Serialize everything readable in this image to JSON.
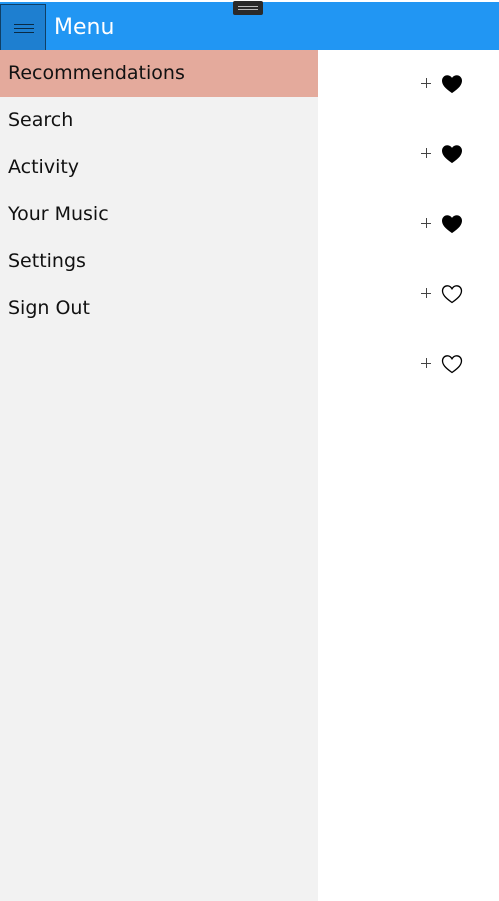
{
  "header": {
    "title": "Menu"
  },
  "sidebar": {
    "selected_index": 0,
    "items": [
      {
        "label": "Recommendations"
      },
      {
        "label": "Search"
      },
      {
        "label": "Activity"
      },
      {
        "label": "Your Music"
      },
      {
        "label": "Settings"
      },
      {
        "label": "Sign Out"
      }
    ]
  },
  "content": {
    "rows": [
      {
        "add_icon": "plus-icon",
        "favorite_icon": "heart-filled-icon",
        "favorited": true
      },
      {
        "add_icon": "plus-icon",
        "favorite_icon": "heart-filled-icon",
        "favorited": true
      },
      {
        "add_icon": "plus-icon",
        "favorite_icon": "heart-filled-icon",
        "favorited": true
      },
      {
        "add_icon": "plus-icon",
        "favorite_icon": "heart-outline-icon",
        "favorited": false
      },
      {
        "add_icon": "plus-icon",
        "favorite_icon": "heart-outline-icon",
        "favorited": false
      }
    ]
  },
  "colors": {
    "titlebar": "#2196f3",
    "hamburger_button": "#1e7fd0",
    "sidebar_background": "#f2f2f2",
    "selected_item": "#e4aa9c",
    "content_background": "#ffffff"
  }
}
